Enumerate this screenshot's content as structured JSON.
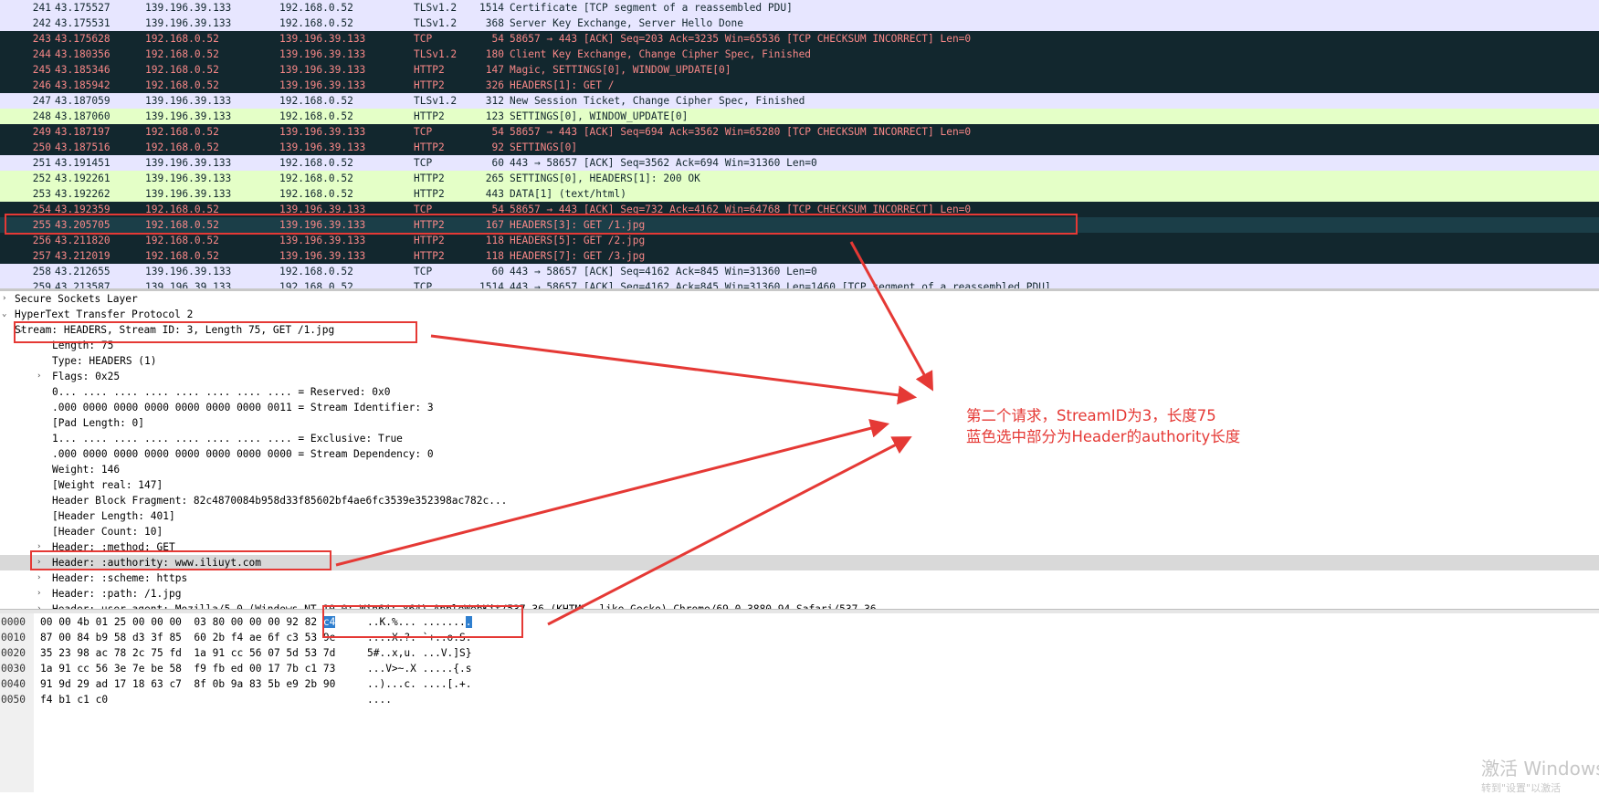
{
  "packets": [
    {
      "no": "241",
      "time": "43.175527",
      "src": "139.196.39.133",
      "dst": "192.168.0.52",
      "proto": "TLSv1.2",
      "len": "1514",
      "info": "Certificate [TCP segment of a reassembled PDU]",
      "style": "tls"
    },
    {
      "no": "242",
      "time": "43.175531",
      "src": "139.196.39.133",
      "dst": "192.168.0.52",
      "proto": "TLSv1.2",
      "len": "368",
      "info": "Server Key Exchange, Server Hello Done",
      "style": "tls"
    },
    {
      "no": "243",
      "time": "43.175628",
      "src": "192.168.0.52",
      "dst": "139.196.39.133",
      "proto": "TCP",
      "len": "54",
      "info": "58657 → 443 [ACK] Seq=203 Ack=3235 Win=65536 [TCP CHECKSUM INCORRECT] Len=0",
      "style": "bad"
    },
    {
      "no": "244",
      "time": "43.180356",
      "src": "192.168.0.52",
      "dst": "139.196.39.133",
      "proto": "TLSv1.2",
      "len": "180",
      "info": "Client Key Exchange, Change Cipher Spec, Finished",
      "style": "bad"
    },
    {
      "no": "245",
      "time": "43.185346",
      "src": "192.168.0.52",
      "dst": "139.196.39.133",
      "proto": "HTTP2",
      "len": "147",
      "info": "Magic, SETTINGS[0], WINDOW_UPDATE[0]",
      "style": "bad"
    },
    {
      "no": "246",
      "time": "43.185942",
      "src": "192.168.0.52",
      "dst": "139.196.39.133",
      "proto": "HTTP2",
      "len": "326",
      "info": "HEADERS[1]: GET /",
      "style": "bad"
    },
    {
      "no": "247",
      "time": "43.187059",
      "src": "139.196.39.133",
      "dst": "192.168.0.52",
      "proto": "TLSv1.2",
      "len": "312",
      "info": "New Session Ticket, Change Cipher Spec, Finished",
      "style": "tls"
    },
    {
      "no": "248",
      "time": "43.187060",
      "src": "139.196.39.133",
      "dst": "192.168.0.52",
      "proto": "HTTP2",
      "len": "123",
      "info": "SETTINGS[0], WINDOW_UPDATE[0]",
      "style": "http"
    },
    {
      "no": "249",
      "time": "43.187197",
      "src": "192.168.0.52",
      "dst": "139.196.39.133",
      "proto": "TCP",
      "len": "54",
      "info": "58657 → 443 [ACK] Seq=694 Ack=3562 Win=65280 [TCP CHECKSUM INCORRECT] Len=0",
      "style": "bad"
    },
    {
      "no": "250",
      "time": "43.187516",
      "src": "192.168.0.52",
      "dst": "139.196.39.133",
      "proto": "HTTP2",
      "len": "92",
      "info": "SETTINGS[0]",
      "style": "bad"
    },
    {
      "no": "251",
      "time": "43.191451",
      "src": "139.196.39.133",
      "dst": "192.168.0.52",
      "proto": "TCP",
      "len": "60",
      "info": "443 → 58657 [ACK] Seq=3562 Ack=694 Win=31360 Len=0",
      "style": "tcp"
    },
    {
      "no": "252",
      "time": "43.192261",
      "src": "139.196.39.133",
      "dst": "192.168.0.52",
      "proto": "HTTP2",
      "len": "265",
      "info": "SETTINGS[0], HEADERS[1]: 200 OK",
      "style": "http"
    },
    {
      "no": "253",
      "time": "43.192262",
      "src": "139.196.39.133",
      "dst": "192.168.0.52",
      "proto": "HTTP2",
      "len": "443",
      "info": "DATA[1] (text/html)",
      "style": "http"
    },
    {
      "no": "254",
      "time": "43.192359",
      "src": "192.168.0.52",
      "dst": "139.196.39.133",
      "proto": "TCP",
      "len": "54",
      "info": "58657 → 443 [ACK] Seq=732 Ack=4162 Win=64768 [TCP CHECKSUM INCORRECT] Len=0",
      "style": "bad"
    },
    {
      "no": "255",
      "time": "43.205705",
      "src": "192.168.0.52",
      "dst": "139.196.39.133",
      "proto": "HTTP2",
      "len": "167",
      "info": "HEADERS[3]: GET /1.jpg",
      "style": "selected"
    },
    {
      "no": "256",
      "time": "43.211820",
      "src": "192.168.0.52",
      "dst": "139.196.39.133",
      "proto": "HTTP2",
      "len": "118",
      "info": "HEADERS[5]: GET /2.jpg",
      "style": "bad"
    },
    {
      "no": "257",
      "time": "43.212019",
      "src": "192.168.0.52",
      "dst": "139.196.39.133",
      "proto": "HTTP2",
      "len": "118",
      "info": "HEADERS[7]: GET /3.jpg",
      "style": "bad"
    },
    {
      "no": "258",
      "time": "43.212655",
      "src": "139.196.39.133",
      "dst": "192.168.0.52",
      "proto": "TCP",
      "len": "60",
      "info": "443 → 58657 [ACK] Seq=4162 Ack=845 Win=31360 Len=0",
      "style": "tcp"
    },
    {
      "no": "259",
      "time": "43.213587",
      "src": "139.196.39.133",
      "dst": "192.168.0.52",
      "proto": "TCP",
      "len": "1514",
      "info": "443 → 58657 [ACK] Seq=4162 Ack=845 Win=31360 Len=1460 [TCP segment of a reassembled PDU]",
      "style": "tcp"
    }
  ],
  "row_colors": {
    "tls": {
      "bg": "#e7e6ff",
      "fg": "#12272e"
    },
    "http": {
      "bg": "#e4ffc7",
      "fg": "#12272e"
    },
    "tcp": {
      "bg": "#e7e6ff",
      "fg": "#12272e"
    },
    "bad": {
      "bg": "#12272e",
      "fg": "#f78787"
    },
    "selected": {
      "bg": "#1b3e48",
      "fg": "#f78787"
    }
  },
  "detail": [
    {
      "indent": 0,
      "exp": "›",
      "text": "Secure Sockets Layer"
    },
    {
      "indent": 0,
      "exp": "⌄",
      "text": "HyperText Transfer Protocol 2"
    },
    {
      "indent": 1,
      "exp": "⌄",
      "text": "Stream: HEADERS, Stream ID: 3, Length 75, GET /1.jpg"
    },
    {
      "indent": 2,
      "exp": "",
      "text": "Length: 75"
    },
    {
      "indent": 2,
      "exp": "",
      "text": "Type: HEADERS (1)"
    },
    {
      "indent": 2,
      "exp": "›",
      "text": "Flags: 0x25"
    },
    {
      "indent": 2,
      "exp": "",
      "text": "0... .... .... .... .... .... .... .... = Reserved: 0x0"
    },
    {
      "indent": 2,
      "exp": "",
      "text": ".000 0000 0000 0000 0000 0000 0000 0011 = Stream Identifier: 3"
    },
    {
      "indent": 2,
      "exp": "",
      "text": "[Pad Length: 0]"
    },
    {
      "indent": 2,
      "exp": "",
      "text": "1... .... .... .... .... .... .... .... = Exclusive: True"
    },
    {
      "indent": 2,
      "exp": "",
      "text": ".000 0000 0000 0000 0000 0000 0000 0000 = Stream Dependency: 0"
    },
    {
      "indent": 2,
      "exp": "",
      "text": "Weight: 146"
    },
    {
      "indent": 2,
      "exp": "",
      "text": "[Weight real: 147]"
    },
    {
      "indent": 2,
      "exp": "",
      "text": "Header Block Fragment: 82c4870084b958d33f85602bf4ae6fc3539e352398ac782c..."
    },
    {
      "indent": 2,
      "exp": "",
      "text": "[Header Length: 401]"
    },
    {
      "indent": 2,
      "exp": "",
      "text": "[Header Count: 10]"
    },
    {
      "indent": 2,
      "exp": "›",
      "text": "Header: :method: GET"
    },
    {
      "indent": 2,
      "exp": "›",
      "text": "Header: :authority: www.iliuyt.com",
      "hl": true
    },
    {
      "indent": 2,
      "exp": "›",
      "text": "Header: :scheme: https"
    },
    {
      "indent": 2,
      "exp": "›",
      "text": "Header: :path: /1.jpg"
    },
    {
      "indent": 2,
      "exp": "›",
      "text": "Header: user-agent: Mozilla/5.0 (Windows NT 10.0; Win64; x64) AppleWebKit/537.36 (KHTML, like Gecko) Chrome/69.0.3880.94 Safari/537.36"
    }
  ],
  "bytes": [
    {
      "off": "0000",
      "hex_pre": "00 00 4b 01 25 00 00 00  03 80 00 00 00 92 82 ",
      "hex_sel": "c4",
      "ascii_pre": "..K.%... .......",
      "ascii_sel": "."
    },
    {
      "off": "0010",
      "hex_pre": "87 00 84 b9 58 d3 3f 85  60 2b f4 ae 6f c3 53 9e",
      "hex_sel": "",
      "ascii_pre": "....X.?. `+..o.S.",
      "ascii_sel": ""
    },
    {
      "off": "0020",
      "hex_pre": "35 23 98 ac 78 2c 75 fd  1a 91 cc 56 07 5d 53 7d",
      "hex_sel": "",
      "ascii_pre": "5#..x,u. ...V.]S}",
      "ascii_sel": ""
    },
    {
      "off": "0030",
      "hex_pre": "1a 91 cc 56 3e 7e be 58  f9 fb ed 00 17 7b c1 73",
      "hex_sel": "",
      "ascii_pre": "...V>~.X .....{.s",
      "ascii_sel": ""
    },
    {
      "off": "0040",
      "hex_pre": "91 9d 29 ad 17 18 63 c7  8f 0b 9a 83 5b e9 2b 90",
      "hex_sel": "",
      "ascii_pre": "..)...c. ....[.+.",
      "ascii_sel": ""
    },
    {
      "off": "0050",
      "hex_pre": "f4 b1 c1 c0",
      "hex_sel": "",
      "ascii_pre": "....",
      "ascii_sel": ""
    }
  ],
  "annotation": {
    "line1": "第二个请求，StreamID为3，长度75",
    "line2": "蓝色选中部分为Header的authority长度"
  },
  "watermark": {
    "line1": "激活 Windows",
    "line2": "转到\"设置\"以激活"
  },
  "colors": {
    "annotation_red": "#e53935",
    "selection_blue": "#2f7fcf"
  }
}
